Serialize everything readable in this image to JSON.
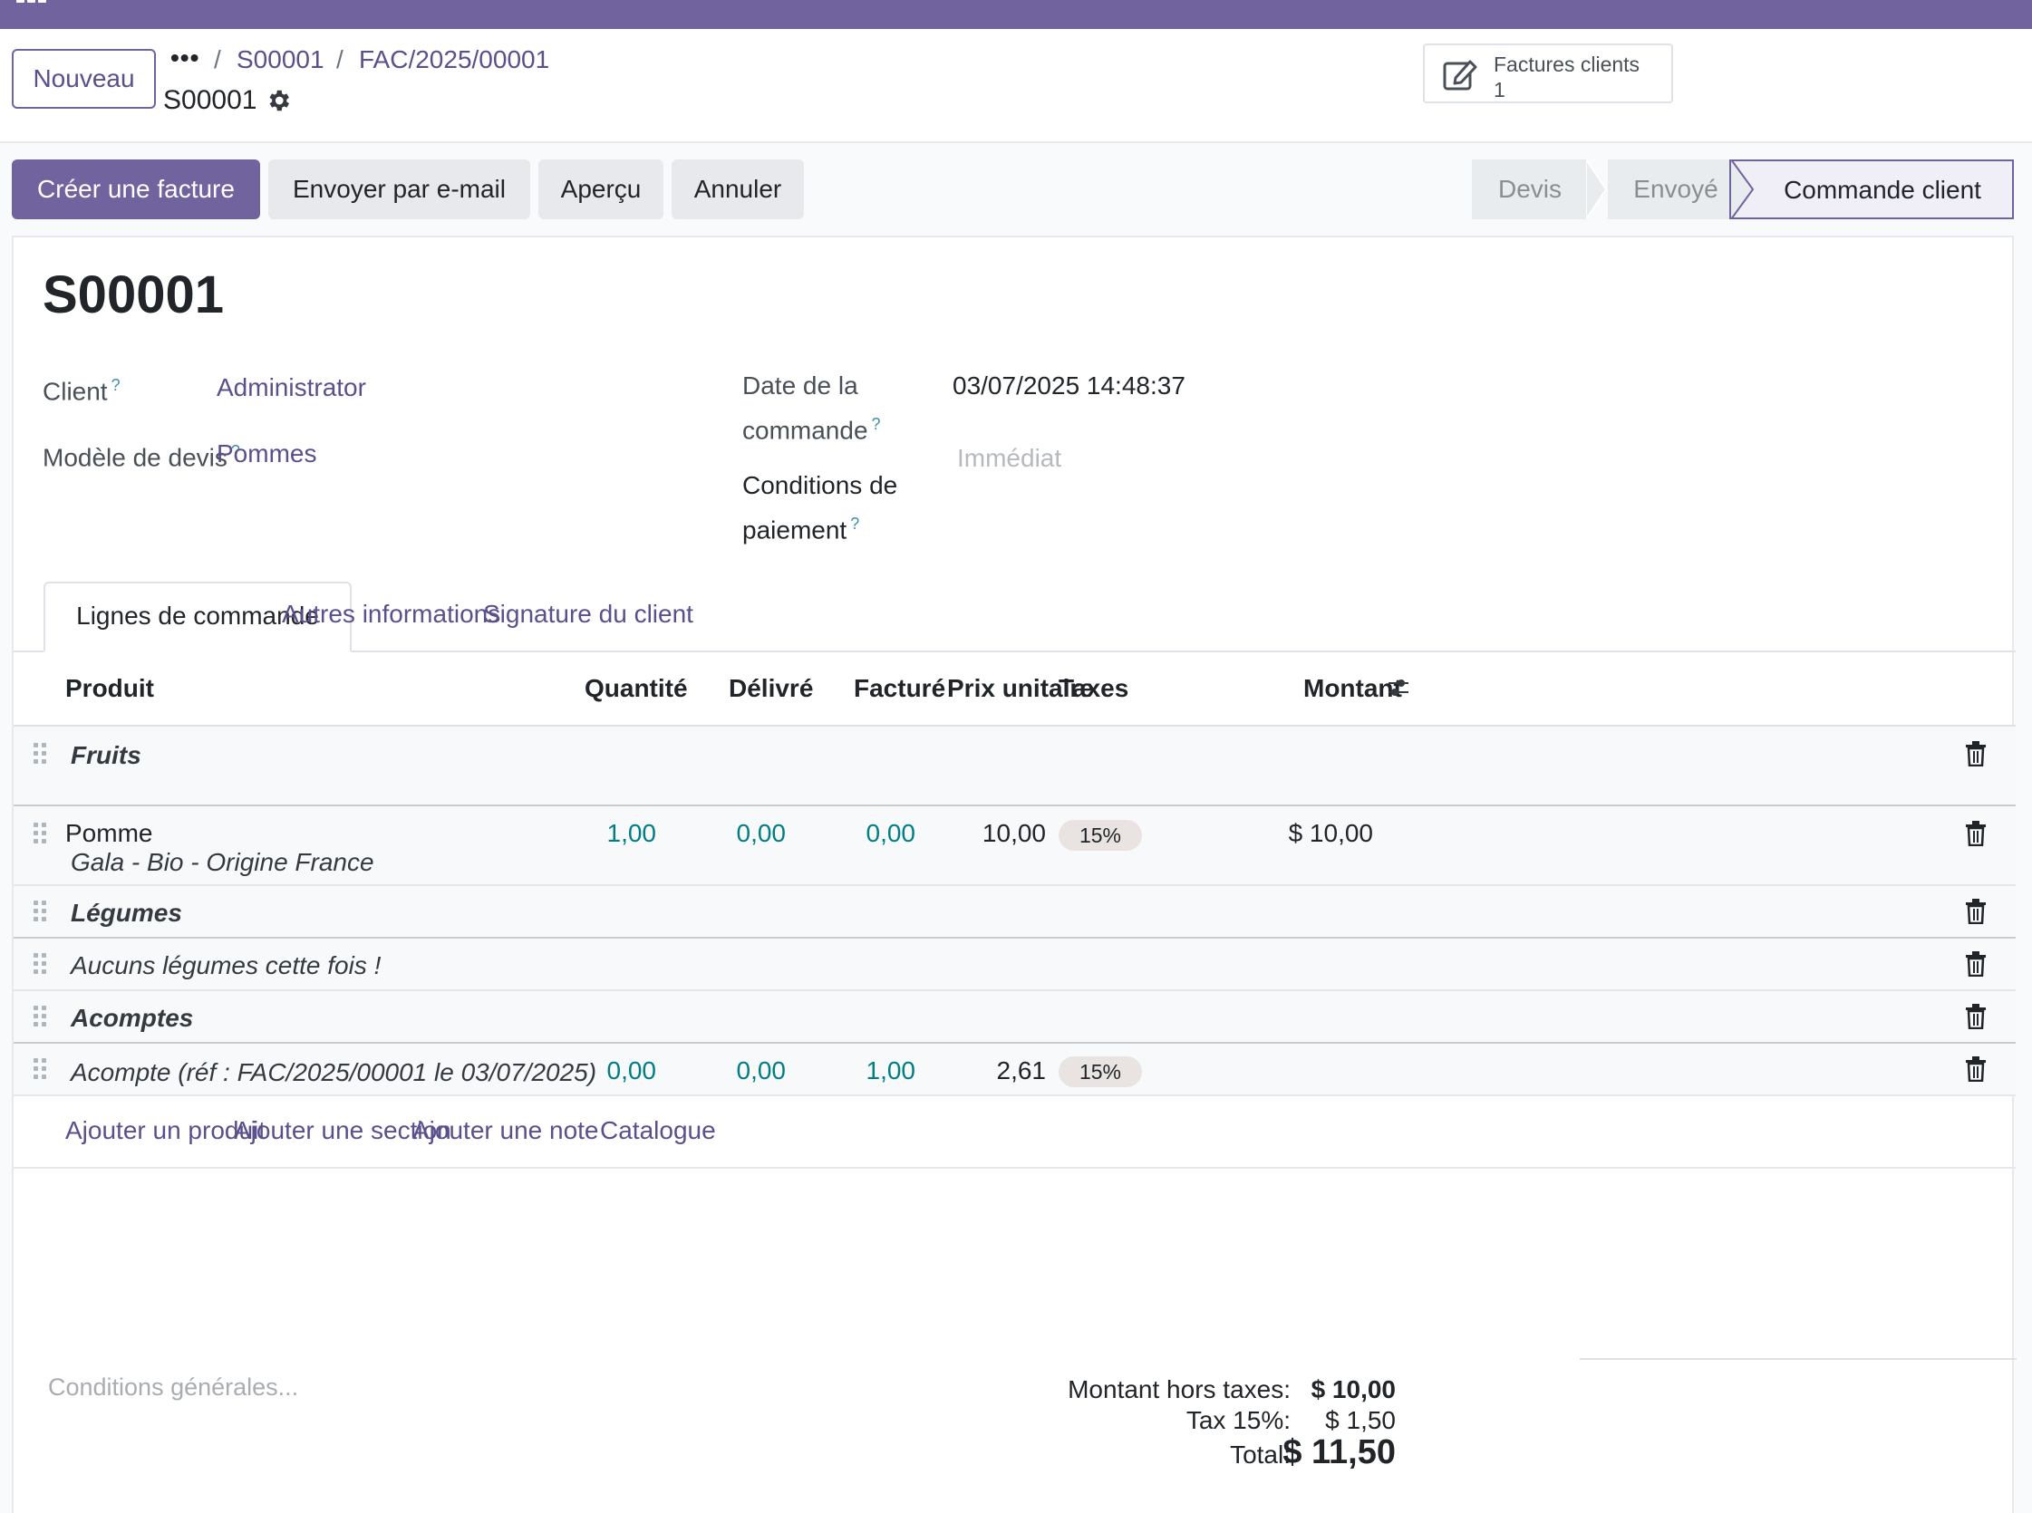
{
  "header": {
    "new_button": "Nouveau",
    "breadcrumb": {
      "dots": "•••",
      "sep": "/",
      "item1": "S00001",
      "item2": "FAC/2025/00001"
    },
    "record_name": "S00001",
    "smart_button": {
      "label": "Factures clients",
      "count": "1"
    }
  },
  "actions": {
    "create_invoice": "Créer une facture",
    "send_email": "Envoyer par e-mail",
    "preview": "Aperçu",
    "cancel": "Annuler"
  },
  "status": {
    "stages": [
      "Devis",
      "Envoyé"
    ],
    "current": "Commande client"
  },
  "form": {
    "title": "S00001",
    "customer_label": "Client",
    "customer_value": "Administrator",
    "template_label": "Modèle de devis",
    "template_value": "Pommes",
    "date_label_1": "Date de la",
    "date_label_2": "commande",
    "date_value": "03/07/2025 14:48:37",
    "payment_label_1": "Conditions de",
    "payment_label_2": "paiement",
    "payment_placeholder": "Immédiat",
    "help": "?"
  },
  "tabs": [
    "Lignes de commande",
    "Autres informations",
    "Signature du client"
  ],
  "lines": {
    "columns": {
      "product": "Produit",
      "qty": "Quantité",
      "delivered": "Délivré",
      "invoiced": "Facturé",
      "price": "Prix unitaire",
      "taxes": "Taxes",
      "amount": "Montant"
    },
    "section_fruits": "Fruits",
    "product_name": "Pomme",
    "product_desc": "Gala - Bio - Origine France",
    "product_qty": "1,00",
    "product_delivered": "0,00",
    "product_invoiced": "0,00",
    "product_price": "10,00",
    "product_tax": "15%",
    "product_amount": "$ 10,00",
    "section_vegetables": "Légumes",
    "note": "Aucuns légumes cette fois !",
    "section_downpayments": "Acomptes",
    "downpayment_name": "Acompte (réf : FAC/2025/00001 le 03/07/2025)",
    "downpayment_qty": "0,00",
    "downpayment_delivered": "0,00",
    "downpayment_invoiced": "1,00",
    "downpayment_price": "2,61",
    "downpayment_tax": "15%",
    "add_product": "Ajouter un produit",
    "add_section": "Ajouter une section",
    "add_note": "Ajouter une note",
    "catalog": "Catalogue"
  },
  "footer": {
    "terms_placeholder": "Conditions générales...",
    "untaxed_label": "Montant hors taxes:",
    "untaxed_value": "$ 10,00",
    "tax_label": "Tax 15%:",
    "tax_value": "$ 1,50",
    "total_label": "Total:",
    "total_value": "$ 11,50"
  },
  "colors": {
    "brand": "#71639e",
    "link": "#5b4f8c",
    "number": "#017e84"
  }
}
